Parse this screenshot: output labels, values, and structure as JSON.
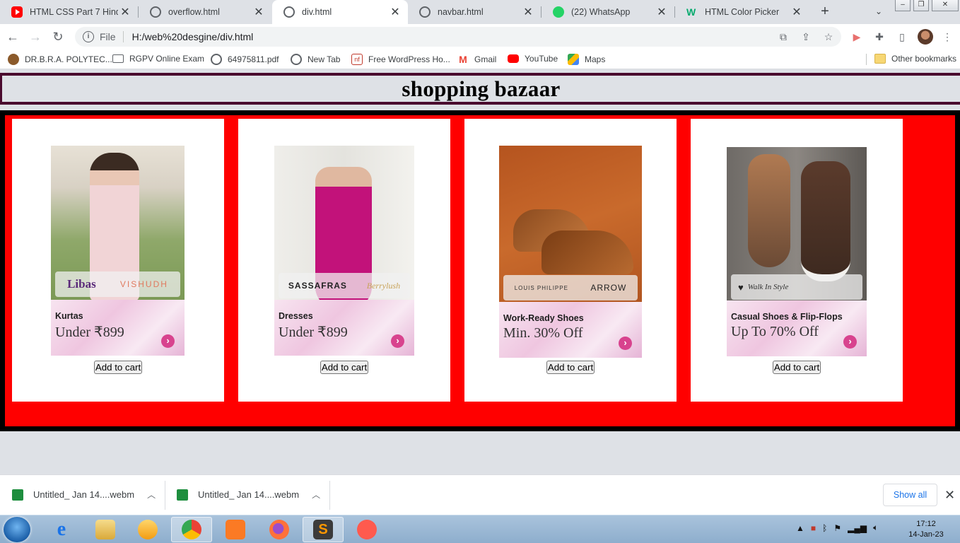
{
  "browser": {
    "tabs": [
      {
        "title": "HTML CSS Part 7 Hindi",
        "icon": "youtube-icon",
        "active": false
      },
      {
        "title": "overflow.html",
        "icon": "globe-icon",
        "active": false
      },
      {
        "title": "div.html",
        "icon": "globe-icon",
        "active": true
      },
      {
        "title": "navbar.html",
        "icon": "globe-icon",
        "active": false
      },
      {
        "title": "(22) WhatsApp",
        "icon": "whatsapp-icon",
        "active": false
      },
      {
        "title": "HTML Color Picker",
        "icon": "w3schools-icon",
        "active": false
      }
    ],
    "address": {
      "scheme_label": "File",
      "url": "H:/web%20desgine/div.html"
    },
    "bookmarks": [
      {
        "label": "DR.B.R.A. POLYTEC...",
        "icon": "site-icon"
      },
      {
        "label": "RGPV Online Exam",
        "icon": "monitor-icon"
      },
      {
        "label": "64975811.pdf",
        "icon": "globe-icon"
      },
      {
        "label": "New Tab",
        "icon": "globe-icon"
      },
      {
        "label": "Free WordPress Ho...",
        "icon": "wordpress-host-icon"
      },
      {
        "label": "Gmail",
        "icon": "gmail-icon"
      },
      {
        "label": "YouTube",
        "icon": "youtube-icon"
      },
      {
        "label": "Maps",
        "icon": "maps-icon"
      }
    ],
    "other_bookmarks": "Other bookmarks"
  },
  "page": {
    "title": "shopping bazaar",
    "products": [
      {
        "brand_left": "Libas",
        "brand_right": "VISHUDH",
        "category": "Kurtas",
        "offer": "Under ₹899",
        "button": "Add to cart"
      },
      {
        "brand_left": "SASSAFRAS",
        "brand_right": "Berrylush",
        "category": "Dresses",
        "offer": "Under ₹899",
        "button": "Add to cart"
      },
      {
        "brand_left": "LOUIS PHILIPPE",
        "brand_right": "ARROW",
        "category": "Work-Ready Shoes",
        "offer": "Min. 30% Off",
        "button": "Add to cart"
      },
      {
        "brand_left": "Walk In Style",
        "brand_right": "",
        "category": "Casual Shoes & Flip-Flops",
        "offer": "Up To 70% Off",
        "button": "Add to cart"
      }
    ]
  },
  "downloads": {
    "items": [
      {
        "name": "Untitled_ Jan 14....webm"
      },
      {
        "name": "Untitled_ Jan 14....webm"
      }
    ],
    "show_all": "Show all"
  },
  "taskbar": {
    "time": "17:12",
    "date": "14-Jan-23"
  },
  "colors": {
    "container_bg": "#ff0000",
    "container_border": "#000000",
    "header_border": "#4a0a2e",
    "card_bg": "#ffffff"
  }
}
